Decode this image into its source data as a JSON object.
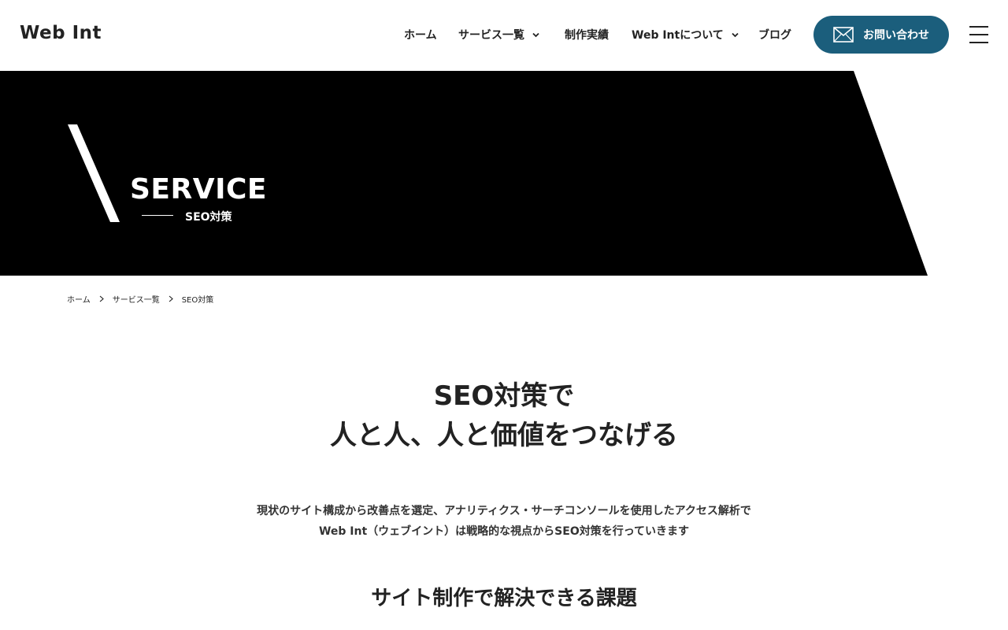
{
  "header": {
    "logo": "Web Int",
    "nav": [
      {
        "label": "ホーム",
        "has_dropdown": false
      },
      {
        "label": "サービス一覧",
        "has_dropdown": true
      },
      {
        "label": "制作実績",
        "has_dropdown": false
      },
      {
        "label": "Web Intについて",
        "has_dropdown": true
      },
      {
        "label": "ブログ",
        "has_dropdown": false
      }
    ],
    "contact_label": "お問い合わせ",
    "menu_icon": "hamburger-icon"
  },
  "hero": {
    "title": "SERVICE",
    "subtitle": "SEO対策"
  },
  "breadcrumb": [
    "ホーム",
    "サービス一覧",
    "SEO対策"
  ],
  "main": {
    "heading_line1": "SEO対策で",
    "heading_line2": "人と人、人と価値をつなげる",
    "lead_line1": "現状のサイト構成から改善点を選定、アナリティクス・サーチコンソールを使用したアクセス解析で",
    "lead_line2": "Web Int（ウェブイント）は戦略的な視点からSEO対策を行っていきます",
    "section_title": "サイト制作で解決できる課題"
  },
  "colors": {
    "accent": "#1b5e7c",
    "hero_bg": "#000000",
    "text": "#222222"
  }
}
